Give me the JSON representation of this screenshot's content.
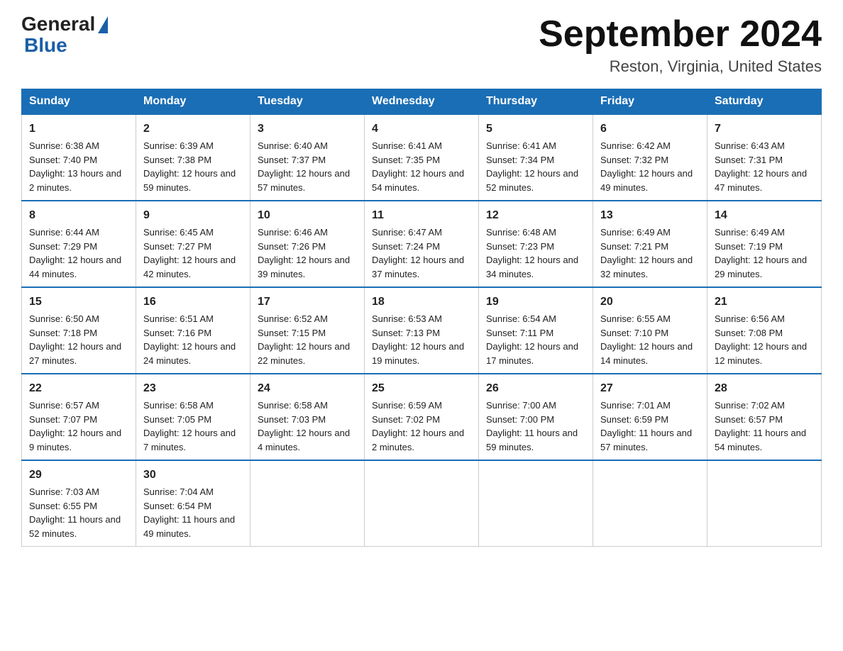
{
  "logo": {
    "name_part1": "General",
    "name_part2": "Blue"
  },
  "title": "September 2024",
  "subtitle": "Reston, Virginia, United States",
  "days_of_week": [
    "Sunday",
    "Monday",
    "Tuesday",
    "Wednesday",
    "Thursday",
    "Friday",
    "Saturday"
  ],
  "weeks": [
    [
      {
        "day": 1,
        "sunrise": "6:38 AM",
        "sunset": "7:40 PM",
        "daylight": "13 hours and 2 minutes."
      },
      {
        "day": 2,
        "sunrise": "6:39 AM",
        "sunset": "7:38 PM",
        "daylight": "12 hours and 59 minutes."
      },
      {
        "day": 3,
        "sunrise": "6:40 AM",
        "sunset": "7:37 PM",
        "daylight": "12 hours and 57 minutes."
      },
      {
        "day": 4,
        "sunrise": "6:41 AM",
        "sunset": "7:35 PM",
        "daylight": "12 hours and 54 minutes."
      },
      {
        "day": 5,
        "sunrise": "6:41 AM",
        "sunset": "7:34 PM",
        "daylight": "12 hours and 52 minutes."
      },
      {
        "day": 6,
        "sunrise": "6:42 AM",
        "sunset": "7:32 PM",
        "daylight": "12 hours and 49 minutes."
      },
      {
        "day": 7,
        "sunrise": "6:43 AM",
        "sunset": "7:31 PM",
        "daylight": "12 hours and 47 minutes."
      }
    ],
    [
      {
        "day": 8,
        "sunrise": "6:44 AM",
        "sunset": "7:29 PM",
        "daylight": "12 hours and 44 minutes."
      },
      {
        "day": 9,
        "sunrise": "6:45 AM",
        "sunset": "7:27 PM",
        "daylight": "12 hours and 42 minutes."
      },
      {
        "day": 10,
        "sunrise": "6:46 AM",
        "sunset": "7:26 PM",
        "daylight": "12 hours and 39 minutes."
      },
      {
        "day": 11,
        "sunrise": "6:47 AM",
        "sunset": "7:24 PM",
        "daylight": "12 hours and 37 minutes."
      },
      {
        "day": 12,
        "sunrise": "6:48 AM",
        "sunset": "7:23 PM",
        "daylight": "12 hours and 34 minutes."
      },
      {
        "day": 13,
        "sunrise": "6:49 AM",
        "sunset": "7:21 PM",
        "daylight": "12 hours and 32 minutes."
      },
      {
        "day": 14,
        "sunrise": "6:49 AM",
        "sunset": "7:19 PM",
        "daylight": "12 hours and 29 minutes."
      }
    ],
    [
      {
        "day": 15,
        "sunrise": "6:50 AM",
        "sunset": "7:18 PM",
        "daylight": "12 hours and 27 minutes."
      },
      {
        "day": 16,
        "sunrise": "6:51 AM",
        "sunset": "7:16 PM",
        "daylight": "12 hours and 24 minutes."
      },
      {
        "day": 17,
        "sunrise": "6:52 AM",
        "sunset": "7:15 PM",
        "daylight": "12 hours and 22 minutes."
      },
      {
        "day": 18,
        "sunrise": "6:53 AM",
        "sunset": "7:13 PM",
        "daylight": "12 hours and 19 minutes."
      },
      {
        "day": 19,
        "sunrise": "6:54 AM",
        "sunset": "7:11 PM",
        "daylight": "12 hours and 17 minutes."
      },
      {
        "day": 20,
        "sunrise": "6:55 AM",
        "sunset": "7:10 PM",
        "daylight": "12 hours and 14 minutes."
      },
      {
        "day": 21,
        "sunrise": "6:56 AM",
        "sunset": "7:08 PM",
        "daylight": "12 hours and 12 minutes."
      }
    ],
    [
      {
        "day": 22,
        "sunrise": "6:57 AM",
        "sunset": "7:07 PM",
        "daylight": "12 hours and 9 minutes."
      },
      {
        "day": 23,
        "sunrise": "6:58 AM",
        "sunset": "7:05 PM",
        "daylight": "12 hours and 7 minutes."
      },
      {
        "day": 24,
        "sunrise": "6:58 AM",
        "sunset": "7:03 PM",
        "daylight": "12 hours and 4 minutes."
      },
      {
        "day": 25,
        "sunrise": "6:59 AM",
        "sunset": "7:02 PM",
        "daylight": "12 hours and 2 minutes."
      },
      {
        "day": 26,
        "sunrise": "7:00 AM",
        "sunset": "7:00 PM",
        "daylight": "11 hours and 59 minutes."
      },
      {
        "day": 27,
        "sunrise": "7:01 AM",
        "sunset": "6:59 PM",
        "daylight": "11 hours and 57 minutes."
      },
      {
        "day": 28,
        "sunrise": "7:02 AM",
        "sunset": "6:57 PM",
        "daylight": "11 hours and 54 minutes."
      }
    ],
    [
      {
        "day": 29,
        "sunrise": "7:03 AM",
        "sunset": "6:55 PM",
        "daylight": "11 hours and 52 minutes."
      },
      {
        "day": 30,
        "sunrise": "7:04 AM",
        "sunset": "6:54 PM",
        "daylight": "11 hours and 49 minutes."
      },
      null,
      null,
      null,
      null,
      null
    ]
  ]
}
